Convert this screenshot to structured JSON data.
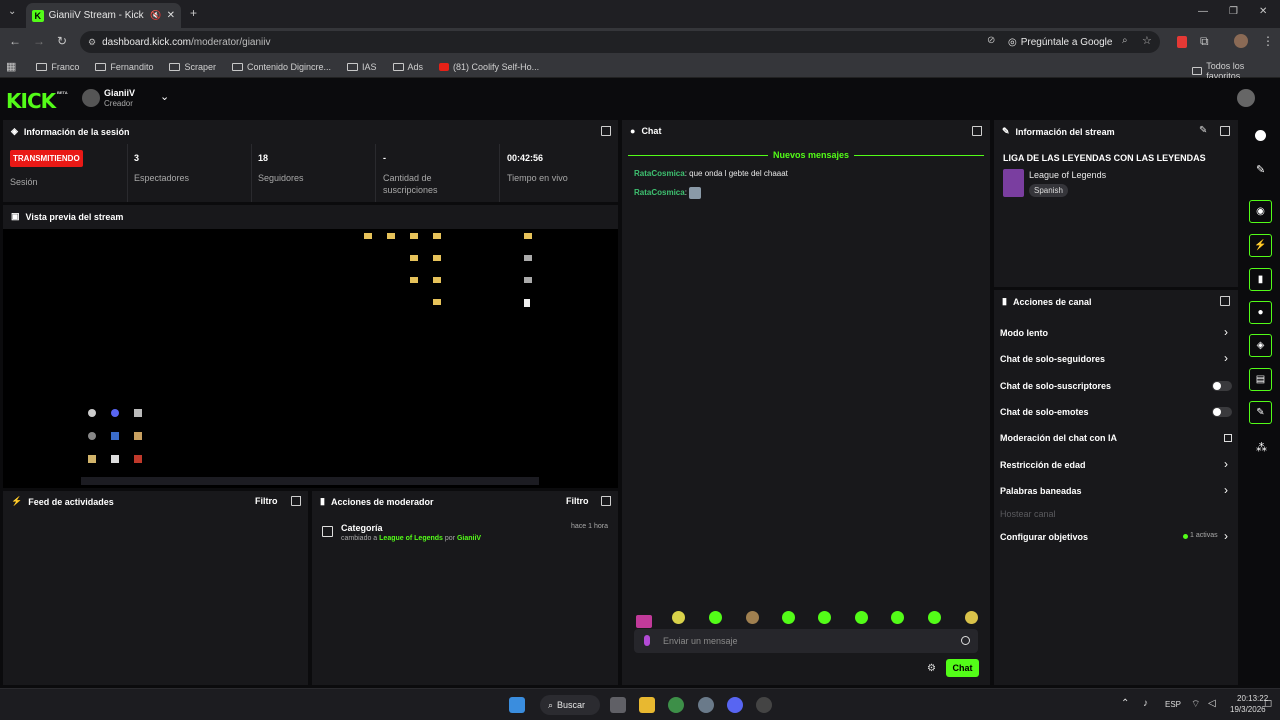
{
  "browser": {
    "tab_title": "GianiiV Stream - Kick Dashb",
    "url_host": "dashboard.kick.com",
    "url_path": "/moderator/gianiiv",
    "ask_google": "Pregúntale a Google",
    "bookmarks": [
      "Franco",
      "Fernandito",
      "Scraper",
      "Contenido Digincre...",
      "IAS",
      "Ads",
      "(81) Coolify Self-Ho..."
    ],
    "all_favorites": "Todos los favoritos"
  },
  "header": {
    "logo": "KICK",
    "logo_tag": "BETA",
    "username": "GianiiV",
    "role": "Creador"
  },
  "session": {
    "title": "Información de la sesión",
    "live_badge": "TRANSMITIENDO",
    "session_label": "Sesión",
    "stats": [
      {
        "value": "3",
        "label": "Espectadores"
      },
      {
        "value": "18",
        "label": "Seguidores"
      },
      {
        "value": "-",
        "label": "Cantidad de suscripciones"
      },
      {
        "value": "00:42:56",
        "label": "Tiempo en vivo"
      }
    ]
  },
  "preview": {
    "title": "Vista previa del stream"
  },
  "activity_feed": {
    "title": "Feed de actividades",
    "filter": "Filtro"
  },
  "mod_actions": {
    "title": "Acciones de moderador",
    "filter": "Filtro",
    "entry": {
      "category": "Categoría",
      "time": "hace 1 hora",
      "prefix": "cambiado a",
      "game": "League of Legends",
      "by": "por",
      "user": "GianiiV"
    }
  },
  "chat": {
    "title": "Chat",
    "new_messages": "Nuevos mensajes",
    "messages": [
      {
        "user": "RataCosmica",
        "text": "que onda l gebte del chaaat"
      },
      {
        "user": "RataCosmica",
        "text": ""
      }
    ],
    "input_placeholder": "Enviar un mensaje",
    "send_label": "Chat"
  },
  "stream_info": {
    "title": "Información del stream",
    "stream_title": "LIGA DE LAS LEYENDAS CON LAS LEYENDAS",
    "category": "League of Legends",
    "language": "Spanish"
  },
  "channel_actions": {
    "title": "Acciones de canal",
    "slow_mode": "Modo lento",
    "followers_only": "Chat de solo-seguidores",
    "subs_only": "Chat de solo-suscriptores",
    "emotes_only": "Chat de solo-emotes",
    "ai_moderation": "Moderación del chat con IA",
    "age_restriction": "Restricción de edad",
    "banned_words": "Palabras baneadas",
    "host_channel": "Hostear canal",
    "goals": "Configurar objetivos",
    "goals_active": "1 activas"
  },
  "taskbar": {
    "search": "Buscar",
    "lang": "ESP",
    "time": "20:13:22",
    "date": "19/3/2026"
  },
  "colors": {
    "accent": "#53fc18",
    "live_red": "#e91916",
    "panel": "#18181b"
  }
}
